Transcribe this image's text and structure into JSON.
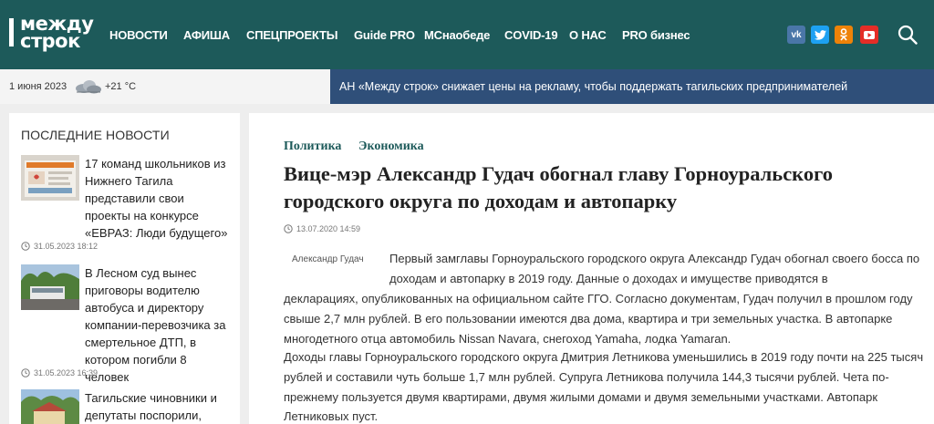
{
  "header": {
    "logo_line1": "между",
    "logo_line2": "строк",
    "nav": [
      "НОВОСТИ",
      "АФИША",
      "СПЕЦПРОЕКТЫ",
      "Guide PRO",
      "МСнаобеде",
      "COVID-19",
      "О НАС",
      "PRO бизнес"
    ],
    "social": [
      {
        "icon": "vk-icon",
        "glyph": "vk",
        "color": "#4a76a8"
      },
      {
        "icon": "twitter-icon",
        "glyph": "🐦",
        "color": "#1da1f2"
      },
      {
        "icon": "odnoklassniki-icon",
        "glyph": "ок",
        "color": "#ee8208"
      },
      {
        "icon": "youtube-icon",
        "glyph": "▶",
        "color": "#e52d27"
      }
    ]
  },
  "subbar": {
    "date": "1 июня 2023",
    "temperature": "+21 °C",
    "ticker": "АН «Между строк» снижает цены на рекламу, чтобы поддержать тагильских предпринимателей"
  },
  "sidebar": {
    "title": "ПОСЛЕДНИЕ НОВОСТИ",
    "items": [
      {
        "title": "17 команд школьников из Нижнего Тагила представили свои проекты на конкурсе «ЕВРАЗ: Люди будущего»",
        "time": "31.05.2023 18:12"
      },
      {
        "title": "В Лесном суд вынес приговоры водителю автобуса и директору компании-перевозчика за смертельное ДТП, в котором погибли 8 человек",
        "time": "31.05.2023 16:39"
      },
      {
        "title": "Тагильские чиновники и депутаты поспорили,",
        "time": ""
      }
    ]
  },
  "article": {
    "rubrics": [
      "Политика",
      "Экономика"
    ],
    "headline": "Вице-мэр Александр Гудач обогнал главу Горноуральского городского округа по доходам и автопарку",
    "published": "13.07.2020 14:59",
    "photo_caption": "Александр Гудач",
    "para1_top": "Первый замглавы Горноуральского городского округа Александр Гудач обогнал своего босса по доходам и автопарку в 2019 году. Данные о доходах и имуществе приводятся в",
    "para1_bottom": "декларациях, опубликованных на официальном сайте ГГО. Согласно документам, Гудач получил в прошлом году свыше 2,7 млн рублей. В его пользовании имеются два дома, квартира и три земельных участка. В автопарке многодетного отца автомобиль Nissan Navara, снегоход Yamaha, лодка Yamaran.",
    "para2": "Доходы главы Горноуральского городского округа Дмитрия Летникова уменьшились в 2019 году почти на 225 тысяч рублей и составили чуть больше 1,7 млн рублей. Супруга Летникова получила 144,3 тысячи рублей. Чета по-прежнему пользуется двумя квартирами, двумя жилыми домами и двумя земельными участками. Автопарк Летниковых пуст."
  }
}
